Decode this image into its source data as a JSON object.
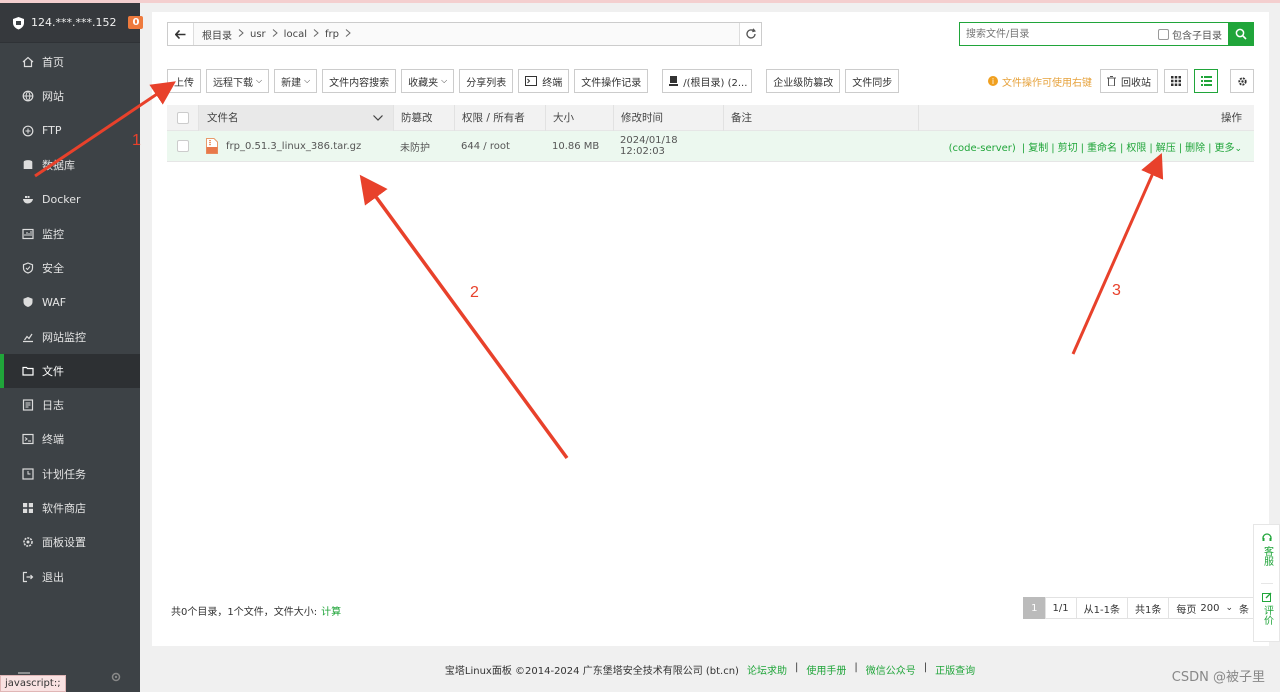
{
  "server": {
    "ip": "124.***.***.152",
    "badge": "0"
  },
  "sidebar": {
    "items": [
      {
        "label": "首页",
        "icon": "home-icon"
      },
      {
        "label": "网站",
        "icon": "globe-icon"
      },
      {
        "label": "FTP",
        "icon": "ftp-icon"
      },
      {
        "label": "数据库",
        "icon": "database-icon"
      },
      {
        "label": "Docker",
        "icon": "docker-icon"
      },
      {
        "label": "监控",
        "icon": "monitor-icon"
      },
      {
        "label": "安全",
        "icon": "shield-icon"
      },
      {
        "label": "WAF",
        "icon": "waf-icon"
      },
      {
        "label": "网站监控",
        "icon": "chart-icon"
      },
      {
        "label": "文件",
        "icon": "folder-icon",
        "active": true
      },
      {
        "label": "日志",
        "icon": "log-icon"
      },
      {
        "label": "终端",
        "icon": "terminal-icon"
      },
      {
        "label": "计划任务",
        "icon": "clock-icon"
      },
      {
        "label": "软件商店",
        "icon": "store-icon"
      },
      {
        "label": "面板设置",
        "icon": "gear-icon"
      },
      {
        "label": "退出",
        "icon": "logout-icon"
      }
    ]
  },
  "status_bar": "javascript:;",
  "breadcrumb": [
    "根目录",
    "usr",
    "local",
    "frp"
  ],
  "search": {
    "placeholder": "搜索文件/目录",
    "include_sub": "包含子目录"
  },
  "toolbar": {
    "upload": "上传",
    "remote_download": "远程下载",
    "new": "新建",
    "content_search": "文件内容搜索",
    "favorites": "收藏夹",
    "share_list": "分享列表",
    "terminal": "终端",
    "op_log": "文件操作记录",
    "disk": "/(根目录) (2...",
    "tamper": "企业级防篡改",
    "sync": "文件同步",
    "tip": "文件操作可使用右键",
    "recycle": "回收站"
  },
  "table": {
    "headers": {
      "name": "文件名",
      "protect": "防篡改",
      "perm": "权限 / 所有者",
      "size": "大小",
      "modified": "修改时间",
      "note": "备注",
      "ops": "操作"
    },
    "rows": [
      {
        "name": "frp_0.51.3_linux_386.tar.gz",
        "protect": "未防护",
        "perm": "644 / root",
        "size": "10.86 MB",
        "modified": "2024/01/18 12:02:03",
        "note": "",
        "ops": {
          "code_server": "(code-server)",
          "copy": "复制",
          "cut": "剪切",
          "rename": "重命名",
          "perm": "权限",
          "extract": "解压",
          "delete": "删除",
          "more": "更多"
        }
      }
    ]
  },
  "summary": {
    "text": "共0个目录，1个文件，文件大小:",
    "calc": "计算"
  },
  "pager": {
    "current": "1",
    "pages": "1/1",
    "range": "从1-1条",
    "total": "共1条",
    "per_page_label": "每页",
    "per_page": "200",
    "unit": "条"
  },
  "footer": {
    "copyright": "宝塔Linux面板 ©2014-2024 广东堡塔安全技术有限公司 (bt.cn)",
    "links": [
      "论坛求助",
      "使用手册",
      "微信公众号",
      "正版查询"
    ],
    "sep": "|"
  },
  "float_help": {
    "service": "客服",
    "review": "评价"
  },
  "watermark": "CSDN @被子里",
  "annotations": [
    "1",
    "2",
    "3"
  ],
  "colors": {
    "accent": "#20a53a",
    "sidebar": "#3d4246",
    "arrow": "#e8412b",
    "badge": "#ee7a3d"
  }
}
